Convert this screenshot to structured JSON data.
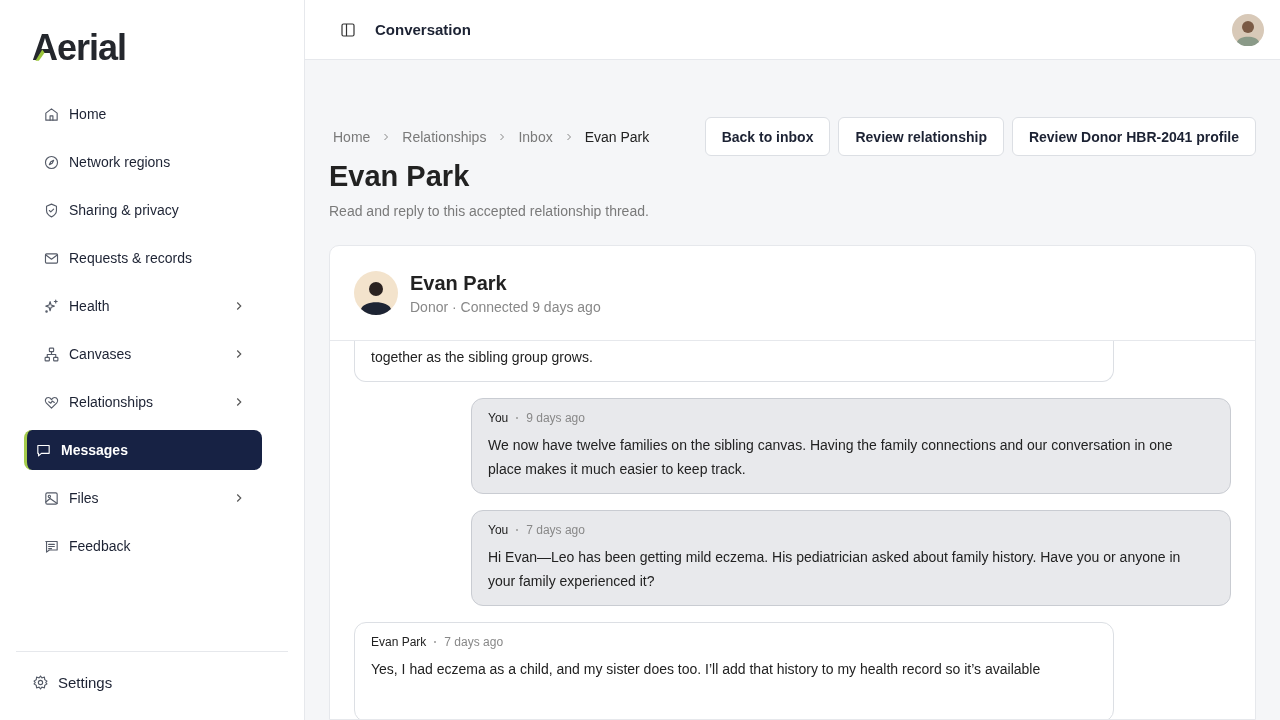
{
  "sidebar": {
    "logo": "Aerial",
    "items": [
      {
        "label": "Home",
        "expandable": false,
        "selected": false
      },
      {
        "label": "Network regions",
        "expandable": false,
        "selected": false
      },
      {
        "label": "Sharing & privacy",
        "expandable": false,
        "selected": false
      },
      {
        "label": "Requests & records",
        "expandable": false,
        "selected": false
      },
      {
        "label": "Health",
        "expandable": true,
        "selected": false
      },
      {
        "label": "Canvases",
        "expandable": true,
        "selected": false
      },
      {
        "label": "Relationships",
        "expandable": true,
        "selected": false
      },
      {
        "label": "Messages",
        "expandable": false,
        "selected": true
      },
      {
        "label": "Files",
        "expandable": true,
        "selected": false
      },
      {
        "label": "Feedback",
        "expandable": false,
        "selected": false
      }
    ],
    "settings": "Settings"
  },
  "topbar": {
    "title": "Conversation"
  },
  "breadcrumbs": [
    "Home",
    "Relationships",
    "Inbox",
    "Evan Park"
  ],
  "actions": [
    "Back to inbox",
    "Review relationship",
    "Review Donor HBR-2041 profile"
  ],
  "page": {
    "title": "Evan Park",
    "subtitle": "Read and reply to this accepted relationship thread."
  },
  "contact": {
    "name": "Evan Park",
    "meta": "Donor · Connected 9 days ago"
  },
  "messages": [
    {
      "kind": "incoming",
      "text": "together as the sibling group grows."
    },
    {
      "kind": "outgoing",
      "sender": "You",
      "time": "9 days ago",
      "text": "We now have twelve families on the sibling canvas. Having the family connections and our conversation in one place makes it much easier to keep track."
    },
    {
      "kind": "outgoing",
      "sender": "You",
      "time": "7 days ago",
      "text": "Hi Evan—Leo has been getting mild eczema. His pediatrician asked about family history. Have you or anyone in your family experienced it?"
    },
    {
      "kind": "incoming",
      "sender": "Evan Park",
      "time": "7 days ago",
      "text": "Yes, I had eczema as a child, and my sister does too. I’ll add that history to my health record so it’s available"
    }
  ]
}
